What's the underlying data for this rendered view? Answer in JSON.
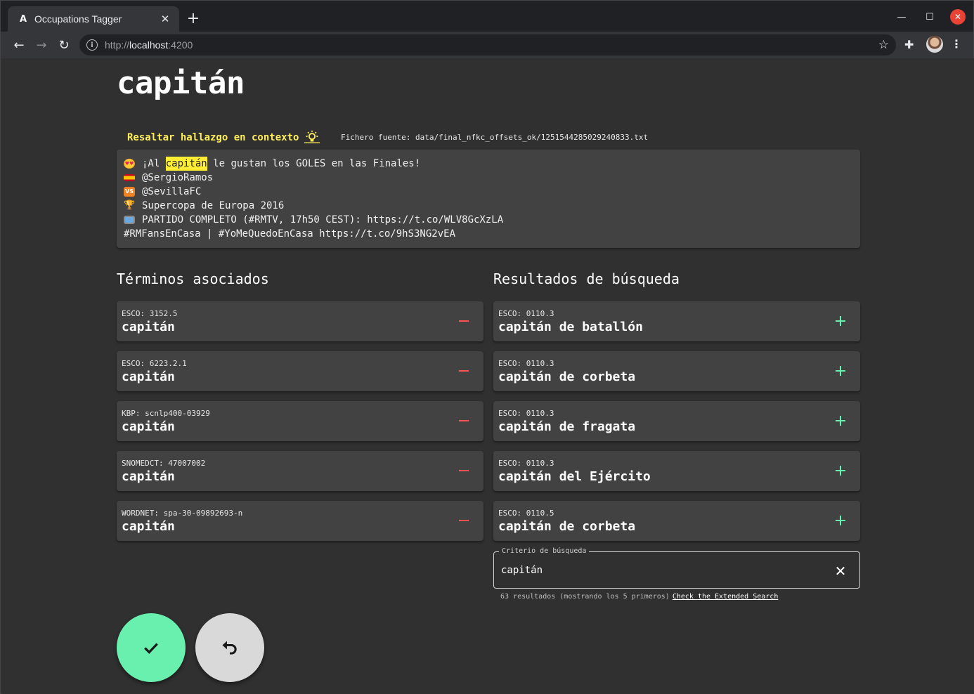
{
  "browser": {
    "tab_title": "Occupations Tagger",
    "favicon_letter": "A",
    "url_scheme": "http://",
    "url_host": "localhost",
    "url_port": ":4200"
  },
  "page": {
    "term": "capitán",
    "highlight_label": "Resaltar hallazgo en contexto",
    "source_file": "Fichero fuente: data/final_nfkc_offsets_ok/1251544285029240833.txt",
    "context": {
      "line1_before": "¡Al ",
      "line1_match": "capitán",
      "line1_after": " le gustan los GOLES en las Finales!",
      "line2": "@SergioRamos",
      "line3": "@SevillaFC",
      "line4": "Supercopa de Europa 2016",
      "line5": "PARTIDO COMPLETO (#RMTV, 17h50 CEST): https://t.co/WLV8GcXzLA",
      "line6": "#RMFansEnCasa | #YoMeQuedoEnCasa https://t.co/9hS3NG2vEA",
      "emoji_vs": "VS"
    },
    "associated_title": "Términos asociados",
    "results_title": "Resultados de búsqueda",
    "associated": [
      {
        "source": "ESCO: 3152.5",
        "label": "capitán"
      },
      {
        "source": "ESCO: 6223.2.1",
        "label": "capitán"
      },
      {
        "source": "KBP: scnlp400-03929",
        "label": "capitán"
      },
      {
        "source": "SNOMEDCT: 47007002",
        "label": "capitán"
      },
      {
        "source": "WORDNET: spa-30-09892693-n",
        "label": "capitán"
      }
    ],
    "results": [
      {
        "source": "ESCO: 0110.3",
        "label": "capitán de batallón"
      },
      {
        "source": "ESCO: 0110.3",
        "label": "capitán de corbeta"
      },
      {
        "source": "ESCO: 0110.3",
        "label": "capitán de fragata"
      },
      {
        "source": "ESCO: 0110.3",
        "label": "capitán del Ejército"
      },
      {
        "source": "ESCO: 0110.5",
        "label": "capitán de corbeta"
      }
    ],
    "search": {
      "legend": "Criterio de búsqueda",
      "value": "capitán",
      "hint": "63 resultados (mostrando los 5 primeros)",
      "link": "Check the Extended Search"
    }
  },
  "colors": {
    "highlight": "#ffee33",
    "remove": "#ff5252",
    "add": "#69f0ae",
    "accept_fab": "#69f0ae",
    "undo_fab": "#d9d9d9"
  }
}
